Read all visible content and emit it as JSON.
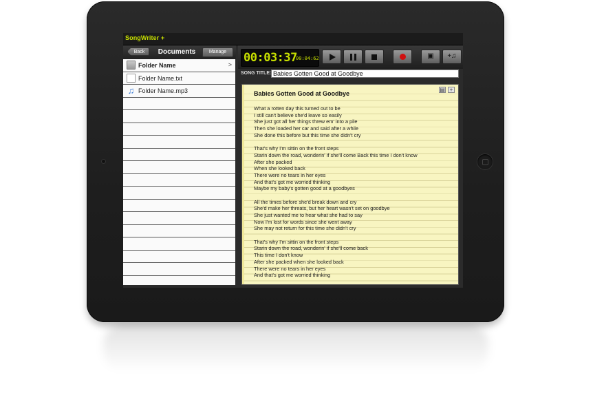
{
  "app": {
    "title": "SongWriter +"
  },
  "documents": {
    "back_label": "Back",
    "title": "Documents",
    "manage_label": "Manage",
    "items": [
      {
        "name": "Folder Name",
        "icon": "folder-icon",
        "chevron": ">"
      },
      {
        "name": "Folder Name.txt",
        "icon": "text-file-icon"
      },
      {
        "name": "Folder Name.mp3",
        "icon": "music-note-icon"
      }
    ]
  },
  "transport": {
    "time": "00:03:37",
    "sub_time": "00:04:62",
    "buttons": [
      "play-icon",
      "pause-icon",
      "stop-icon",
      "record-icon",
      "save-icon",
      "add-music-icon"
    ]
  },
  "song": {
    "title_label": "SONG TITLE:",
    "title_value": "Babies Gotten Good at Goodbye"
  },
  "lyrics": {
    "title": "Babies Gotten Good at Goodbye",
    "lines": [
      "What a rotten day this turned out to be",
      "I still can't believe she'd leave so easily",
      "She just got all her things threw em' into a pile",
      "Then she loaded her car and said after a while",
      "She done this before but this time she didn't cry",
      "",
      "That's why I'm sittin on the front steps",
      "Starin down the road, wonderin' if she'll come Back this time I don't know",
      "After she packed",
      "When she looked back",
      "There were no tears in her eyes",
      "And that's got me worried thinking",
      "Maybe my baby's gotten good at a goodbyes",
      "",
      "All the times before she'd break down and cry",
      "She'd make her threats, but her heart wasn't set on goodbye",
      "She just wanted me to hear what she had to say",
      "Now I'm lost for words since she went away",
      "She may not return for this time she didn't cry",
      "",
      "That's why I'm sittin on the front steps",
      "Starin down the road, wonderin' if she'll come back",
      "This time I don't know",
      "After she packed when she looked back",
      "There were no tears in her eyes",
      "And that's got me worried thinking"
    ]
  }
}
